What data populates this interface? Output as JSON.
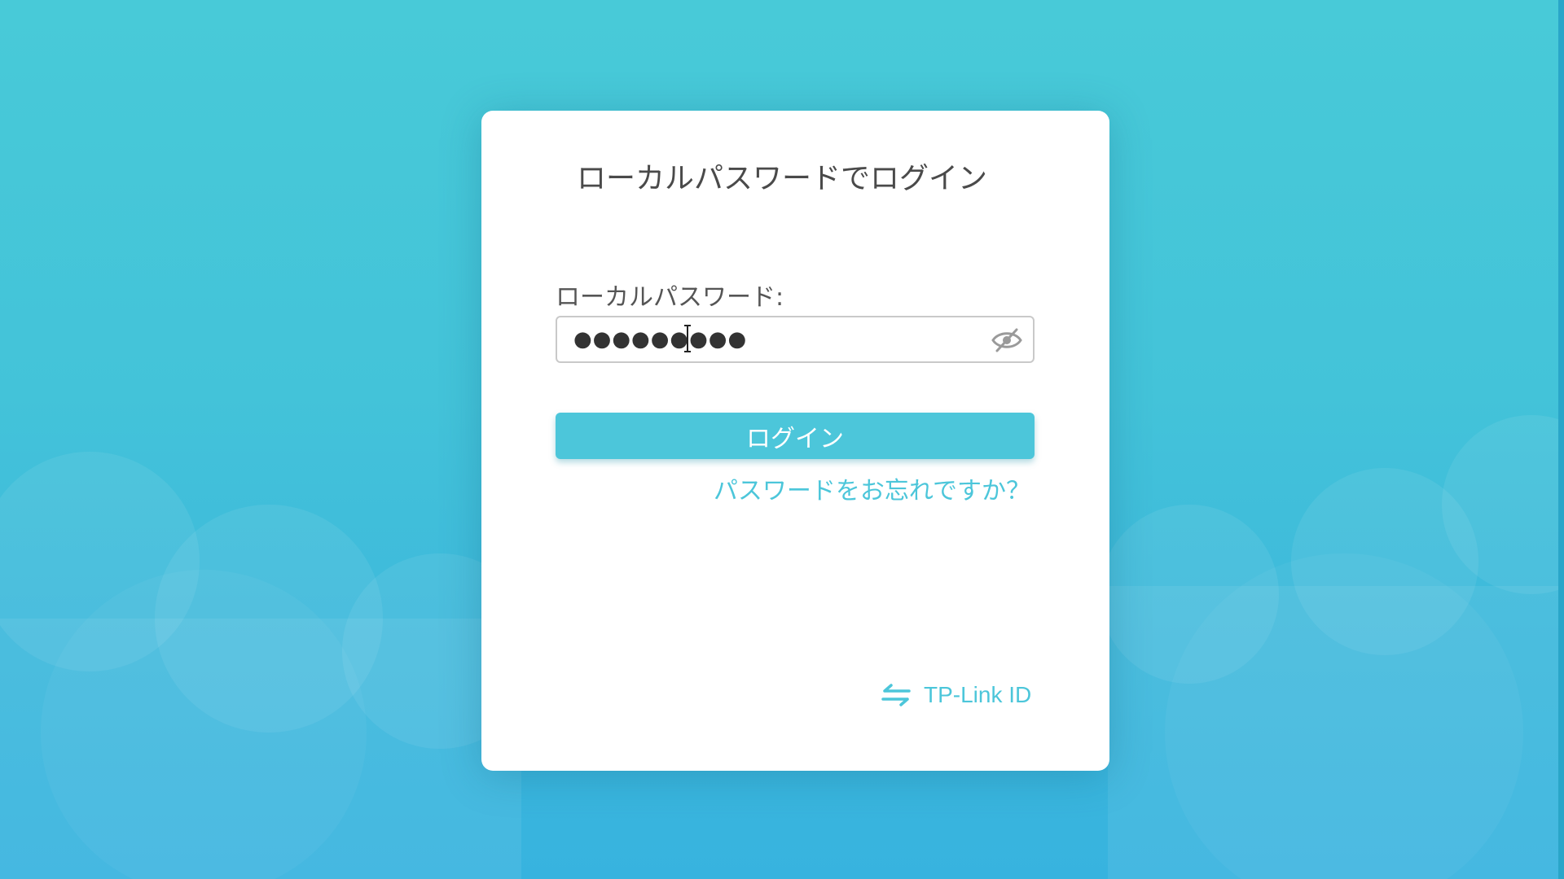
{
  "page": {
    "title": "ローカルパスワードでログイン"
  },
  "form": {
    "password_label": "ローカルパスワード:",
    "password_value": "●●●●●●●●●",
    "login_label": "ログイン",
    "forgot_label": "パスワードをお忘れですか？"
  },
  "footer": {
    "switch_label": "TP-Link ID"
  },
  "icons": {
    "visibility_toggle": "eye-slash-icon",
    "switch_account": "switch-arrows-icon",
    "cursor": "text-cursor-icon"
  },
  "colors": {
    "accent": "#4cc6da",
    "background_top": "#48cad8",
    "background_bottom": "#37b3df",
    "card": "#ffffff",
    "title_text": "#4a4a4a"
  }
}
